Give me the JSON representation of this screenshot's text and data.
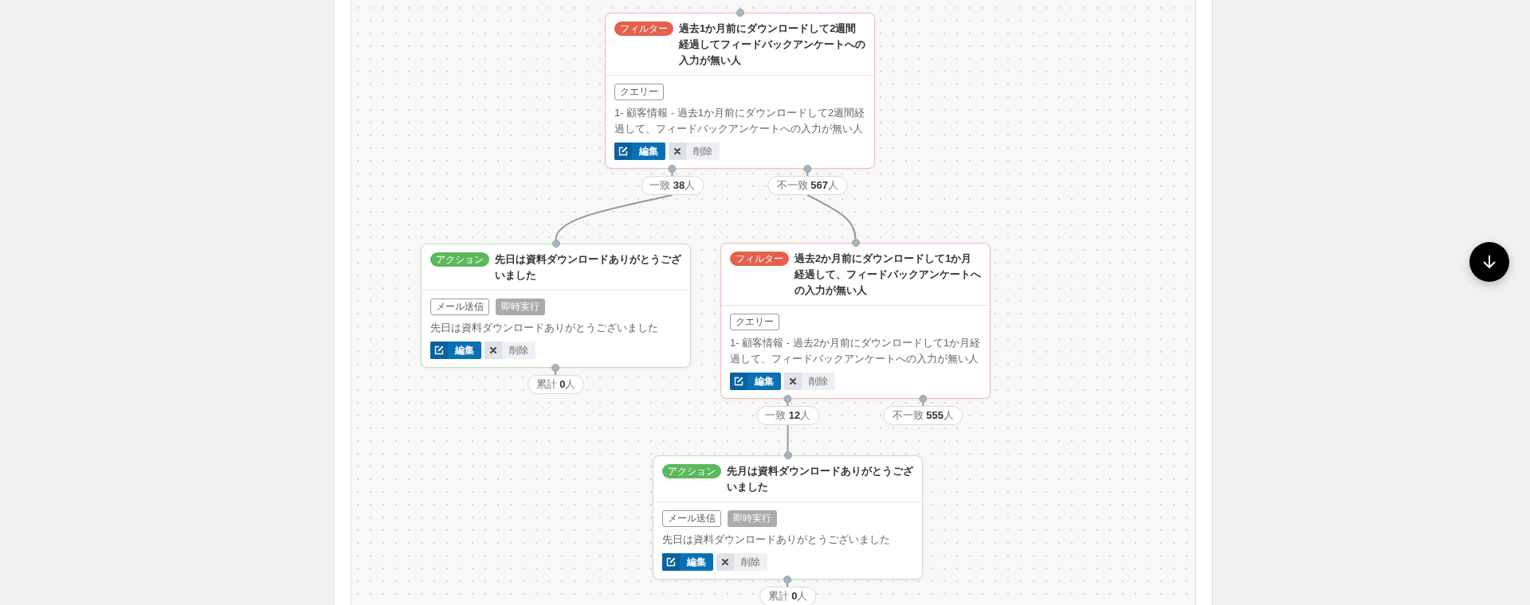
{
  "flow": {
    "node": {
      "kind": "filter",
      "badge": "フィルター",
      "title": "過去1か月前にダウンロードして2週間経過してフィードバックアンケートへの入力が無い人",
      "tags": [
        {
          "kind": "outline",
          "text": "クエリー"
        }
      ],
      "description": "1- 顧客情報 - 過去1か月前にダウンロードして2週間経過して、フィードバックアンケートへの入力が無い人",
      "buttons": [
        {
          "kind": "edit",
          "label": "編集"
        },
        {
          "kind": "delete",
          "label": "削除"
        }
      ],
      "outputs": [
        {
          "label": "一致 **38**人",
          "next": {
            "kind": "action",
            "badge": "アクション",
            "title": "先日は資料ダウンロードありがとうございました",
            "tags": [
              {
                "kind": "outline",
                "text": "メール送信"
              },
              {
                "kind": "filled",
                "text": "即時実行"
              }
            ],
            "description": "先日は資料ダウンロードありがとうございました",
            "buttons": [
              {
                "kind": "edit",
                "label": "編集"
              },
              {
                "kind": "delete",
                "label": "削除"
              }
            ],
            "outputs": [
              {
                "label": "累計 **0**人"
              }
            ]
          }
        },
        {
          "label": "不一致 **567**人",
          "next": {
            "kind": "filter",
            "badge": "フィルター",
            "title": "過去2か月前にダウンロードして1か月経過して、フィードバックアンケートへの入力が無い人",
            "tags": [
              {
                "kind": "outline",
                "text": "クエリー"
              }
            ],
            "description": "1- 顧客情報 - 過去2か月前にダウンロードして1か月経過して、フィードバックアンケートへの入力が無い人",
            "buttons": [
              {
                "kind": "edit",
                "label": "編集"
              },
              {
                "kind": "delete",
                "label": "削除"
              }
            ],
            "outputs": [
              {
                "label": "一致 **12**人",
                "next": {
                  "kind": "action",
                  "badge": "アクション",
                  "title": "先月は資料ダウンロードありがとうございました",
                  "tags": [
                    {
                      "kind": "outline",
                      "text": "メール送信"
                    },
                    {
                      "kind": "filled",
                      "text": "即時実行"
                    }
                  ],
                  "description": "先日は資料ダウンロードありがとうございました",
                  "buttons": [
                    {
                      "kind": "edit",
                      "label": "編集"
                    },
                    {
                      "kind": "delete",
                      "label": "削除"
                    }
                  ],
                  "outputs": [
                    {
                      "label": "累計 **0**人"
                    }
                  ]
                }
              },
              {
                "label": "不一致 **555**人"
              }
            ]
          }
        }
      ]
    }
  }
}
